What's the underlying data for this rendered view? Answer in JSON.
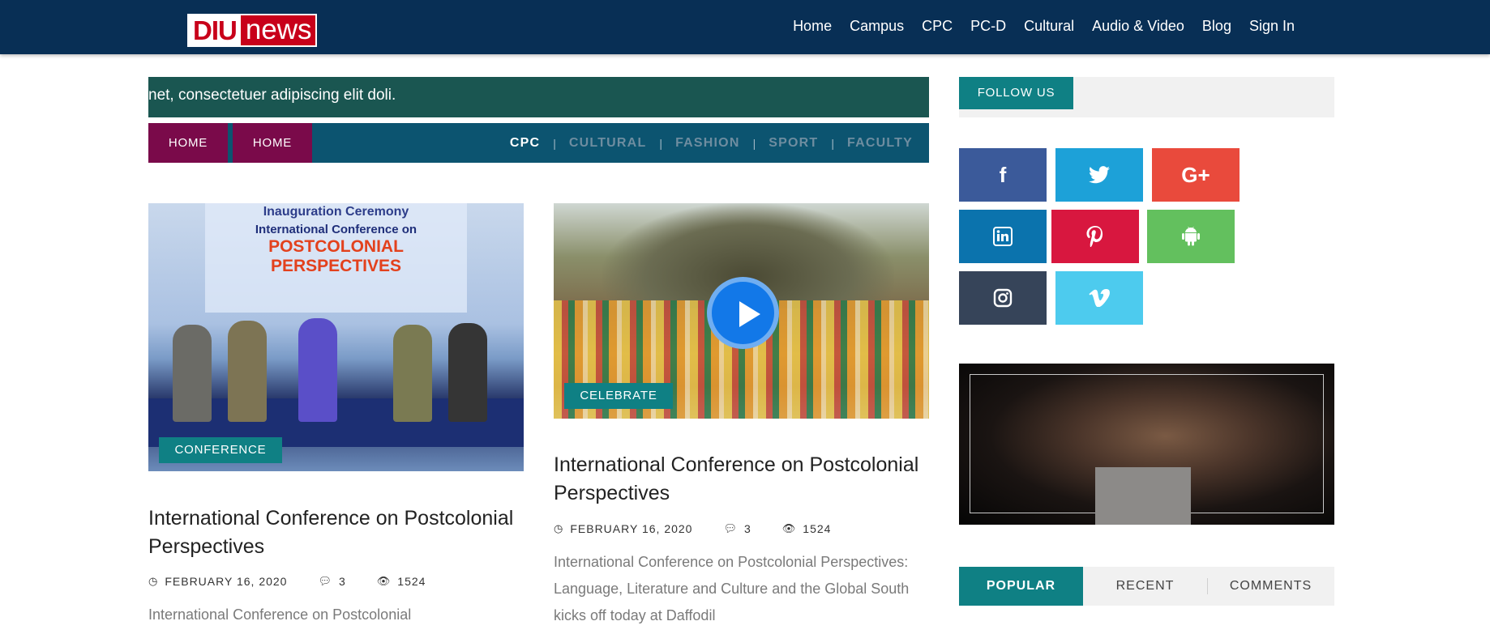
{
  "logo": {
    "part1": "DIU",
    "part2": "news"
  },
  "nav": [
    "Home",
    "Campus",
    "CPC",
    "PC-D",
    "Cultural",
    "Audio & Video",
    "Blog",
    "Sign In"
  ],
  "ticker": "net, consectetuer adipiscing elit doli.",
  "breadcrumb": [
    "HOME",
    "HOME"
  ],
  "categories": [
    {
      "label": "CPC",
      "active": true
    },
    {
      "label": "CULTURAL",
      "active": false
    },
    {
      "label": "FASHION",
      "active": false
    },
    {
      "label": "SPORT",
      "active": false
    },
    {
      "label": "FACULTY",
      "active": false
    }
  ],
  "cards": [
    {
      "image": {
        "banner_title": "Inauguration Ceremony",
        "banner_subtitle": "International Conference on",
        "banner_highlight": "POSTCOLONIAL PERSPECTIVES"
      },
      "tag": "CONFERENCE",
      "title": "International Conference on Postcolonial Perspectives",
      "date": "FEBRUARY 16, 2020",
      "comments": "3",
      "views": "1524",
      "excerpt": "International Conference on Postcolonial"
    },
    {
      "tag": "CELEBRATE",
      "title": "International Conference on Postcolonial Perspectives",
      "date": "FEBRUARY 16, 2020",
      "comments": "3",
      "views": "1524",
      "excerpt": "International Conference on Postcolonial Perspectives: Language, Literature and Culture and the Global South kicks off today at Daffodil"
    }
  ],
  "sidebar": {
    "follow_label": "FOLLOW US",
    "social": [
      {
        "name": "facebook-icon",
        "glyph": "f",
        "color": "#3b5a9a"
      },
      {
        "name": "twitter-icon",
        "glyph": "🐦",
        "color": "#1da1d8"
      },
      {
        "name": "google-plus-icon",
        "glyph": "G+",
        "color": "#e94a3c"
      },
      {
        "name": "linkedin-icon",
        "glyph": "in",
        "color": "#0b73ad"
      },
      {
        "name": "pinterest-icon",
        "glyph": "P",
        "color": "#d8173f"
      },
      {
        "name": "android-icon",
        "glyph": "🤖",
        "color": "#63c05e"
      },
      {
        "name": "instagram-icon",
        "glyph": "◎",
        "color": "#364459"
      },
      {
        "name": "vimeo-icon",
        "glyph": "V",
        "color": "#4dcbee"
      }
    ],
    "tabs": [
      "POPULAR",
      "RECENT",
      "COMMENTS"
    ]
  },
  "colors": {
    "nav_bg": "#082f55",
    "accent": "#0f8084",
    "home_btn": "#7a0a4a",
    "cat_bar": "#0c5470",
    "ticker_bg": "#1a5651"
  }
}
